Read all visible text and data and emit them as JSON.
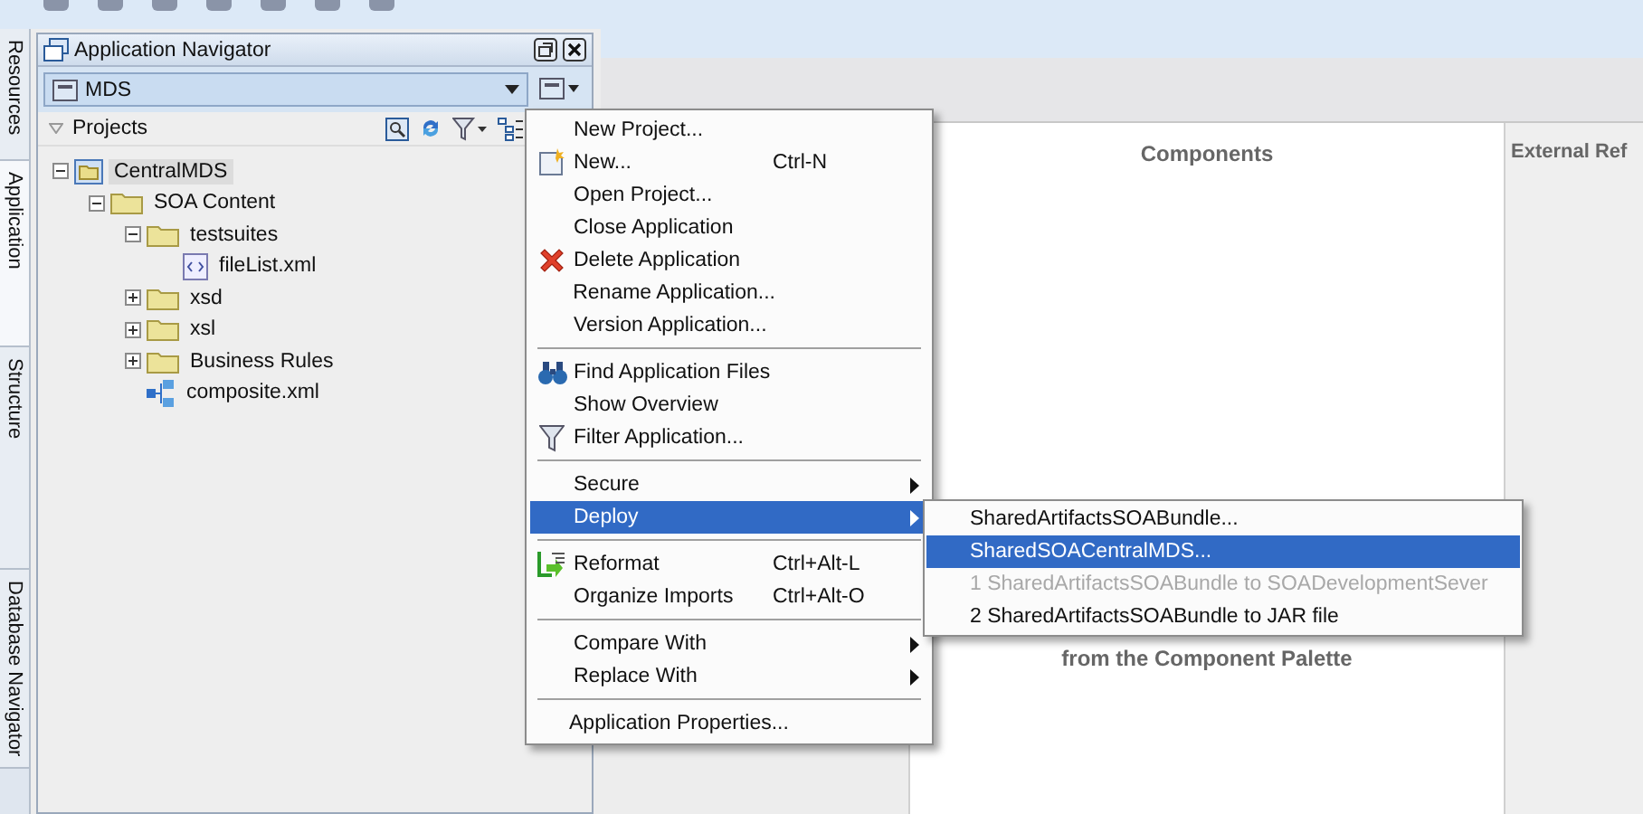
{
  "side_tabs": [
    {
      "label": "Resources",
      "selected": false
    },
    {
      "label": "Application",
      "selected": true
    },
    {
      "label": "Structure",
      "selected": false
    },
    {
      "label": "Database Navigator",
      "selected": false
    }
  ],
  "navigator": {
    "title": "Application Navigator",
    "application": "MDS",
    "section": "Projects",
    "tree": [
      {
        "label": "CentralMDS",
        "kind": "project",
        "expanded": true,
        "selected": true,
        "children": [
          {
            "label": "SOA Content",
            "kind": "folder",
            "expanded": true,
            "selected": false,
            "children": [
              {
                "label": "testsuites",
                "kind": "folder",
                "expanded": true,
                "selected": false,
                "children": [
                  {
                    "label": "fileList.xml",
                    "kind": "xml",
                    "selected": false
                  }
                ]
              },
              {
                "label": "xsd",
                "kind": "folder",
                "expanded": false,
                "selected": false
              },
              {
                "label": "xsl",
                "kind": "folder",
                "expanded": false,
                "selected": false
              },
              {
                "label": "Business Rules",
                "kind": "folder",
                "expanded": false,
                "selected": false
              },
              {
                "label": "composite.xml",
                "kind": "composite",
                "selected": false
              }
            ]
          }
        ]
      }
    ]
  },
  "editor": {
    "columns": [
      "Components",
      "External Ref"
    ],
    "hint": "from the Component Palette"
  },
  "context_menu": {
    "items": [
      {
        "kind": "plain",
        "label": "New Project...",
        "selected": false,
        "submenu": false
      },
      {
        "kind": "new",
        "label": "New...",
        "shortcut": "Ctrl-N",
        "selected": false,
        "submenu": false
      },
      {
        "kind": "plain",
        "label": "Open Project...",
        "selected": false,
        "submenu": false
      },
      {
        "kind": "plain",
        "label": "Close Application",
        "selected": false,
        "submenu": false
      },
      {
        "kind": "delete",
        "label": "Delete Application",
        "selected": false,
        "submenu": false
      },
      {
        "kind": "plain",
        "label": "Rename Application...",
        "selected": false,
        "submenu": false
      },
      {
        "kind": "plain",
        "label": "Version Application...",
        "selected": false,
        "submenu": false
      },
      {
        "kind": "separator"
      },
      {
        "kind": "find",
        "label": "Find Application Files",
        "selected": false,
        "submenu": false
      },
      {
        "kind": "plain",
        "label": "Show Overview",
        "selected": false,
        "submenu": false
      },
      {
        "kind": "filter",
        "label": "Filter Application...",
        "selected": false,
        "submenu": false
      },
      {
        "kind": "separator"
      },
      {
        "kind": "plain",
        "label": "Secure",
        "selected": false,
        "submenu": true
      },
      {
        "kind": "plain",
        "label": "Deploy",
        "selected": true,
        "submenu": true
      },
      {
        "kind": "separator"
      },
      {
        "kind": "reformat",
        "label": "Reformat",
        "shortcut": "Ctrl+Alt-L",
        "selected": false,
        "submenu": false
      },
      {
        "kind": "plain",
        "label": "Organize Imports",
        "shortcut": "Ctrl+Alt-O",
        "selected": false,
        "submenu": false
      },
      {
        "kind": "separator"
      },
      {
        "kind": "plain",
        "label": "Compare With",
        "selected": false,
        "submenu": true
      },
      {
        "kind": "plain",
        "label": "Replace With",
        "selected": false,
        "submenu": true
      },
      {
        "kind": "separator"
      },
      {
        "kind": "plain",
        "label": "Application Properties...",
        "selected": false,
        "submenu": false
      }
    ]
  },
  "deploy_submenu": {
    "items": [
      {
        "label": "SharedArtifactsSOABundle...",
        "selected": false,
        "disabled": false
      },
      {
        "label": "SharedSOACentralMDS...",
        "selected": true,
        "disabled": false
      },
      {
        "label": "1 SharedArtifactsSOABundle to SOADevelopmentSever",
        "selected": false,
        "disabled": true
      },
      {
        "label": "2 SharedArtifactsSOABundle to JAR file",
        "selected": false,
        "disabled": false
      }
    ]
  }
}
